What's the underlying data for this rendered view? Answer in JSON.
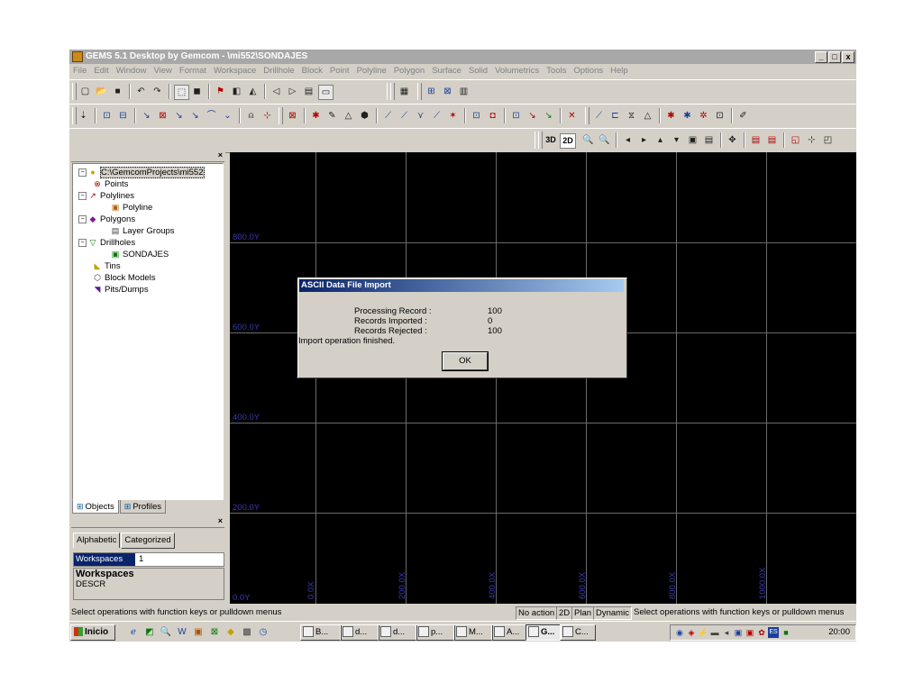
{
  "window": {
    "title": "GEMS 5.1 Desktop by Gemcom - \\mi552\\SONDAJES",
    "buttons": {
      "minimize": "_",
      "maximize": "□",
      "close": "x"
    }
  },
  "menu": [
    "File",
    "Edit",
    "Window",
    "View",
    "Format",
    "Workspace",
    "Drillhole",
    "Block",
    "Point",
    "Polyline",
    "Polygon",
    "Surface",
    "Solid",
    "Volumetrics",
    "Tools",
    "Options",
    "Help"
  ],
  "toolbar3": {
    "btn_3d": "3D",
    "btn_2d": "2D"
  },
  "tree": {
    "root": "C:\\GemcomProjects\\mi552",
    "points": "Points",
    "polylines": "Polylines",
    "polyline": "Polyline",
    "polygons": "Polygons",
    "layer_groups": "Layer Groups",
    "drillholes": "Drillholes",
    "sondajes": "SONDAJES",
    "tins": "Tins",
    "block_models": "Block Models",
    "pits_dumps": "Pits/Dumps"
  },
  "left_tabs": {
    "objects": "Objects",
    "profiles": "Profiles"
  },
  "properties": {
    "tab_alphabetic": "Alphabetic",
    "tab_categorized": "Categorized",
    "key": "Workspaces",
    "value": "1",
    "desc_title": "Workspaces",
    "desc_text": "DESCR"
  },
  "viewport": {
    "y_labels": [
      "800.0Y",
      "600.0Y",
      "400.0Y",
      "200.0Y",
      "0.0Y"
    ],
    "x_labels": [
      "0.0X",
      "200.0X",
      "400.0X",
      "600.0X",
      "800.0X",
      "1000.0X"
    ]
  },
  "dialog": {
    "title": "ASCII Data File Import",
    "processing_label": "Processing Record :",
    "processing_value": "100",
    "imported_label": "Records Imported :",
    "imported_value": "0",
    "rejected_label": "Records Rejected :",
    "rejected_value": "100",
    "message": "Import operation finished.",
    "ok": "OK"
  },
  "status": {
    "left": "Select operations with function keys or pulldown menus",
    "action": "No action",
    "mode_2d": "2D",
    "plan": "Plan",
    "dynamic": "Dynamic",
    "right": "Select operations with function keys or pulldown menus"
  },
  "taskbar": {
    "start": "Inicio",
    "tasks": [
      "B...",
      "d...",
      "d...",
      "p...",
      "M...",
      "A...",
      "G...",
      "C..."
    ],
    "clock": "20:00",
    "lang": "ES"
  }
}
